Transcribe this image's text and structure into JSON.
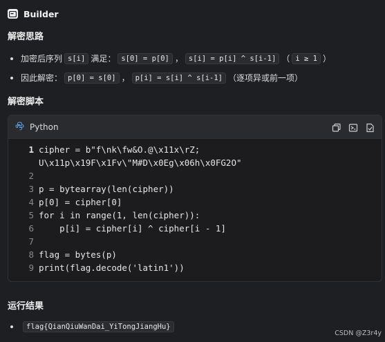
{
  "builder": {
    "label": "Builder",
    "icon": "builder-icon"
  },
  "section1": {
    "title": "解密思路",
    "bullets": [
      {
        "parts": [
          "加密后序列",
          "s[i]",
          "满足：",
          "s[0] = p[0]",
          "，",
          "s[i] = p[i] ^ s[i-1]",
          "（",
          "i ≥ 1",
          "）"
        ]
      },
      {
        "parts": [
          "因此解密：",
          "p[0] = s[0]",
          "，",
          "p[i] = s[i] ^ s[i-1]",
          "（逐项异或前一项）"
        ]
      }
    ]
  },
  "section2": {
    "title": "解密脚本"
  },
  "code": {
    "language": "Python",
    "language_icon": "python-icon",
    "tools": [
      "copy-icon",
      "insert-icon",
      "apply-icon"
    ],
    "line_numbers": [
      "1",
      "2",
      "3",
      "4",
      "5",
      "6",
      "7",
      "8",
      "9"
    ],
    "lines": {
      "l1a": "cipher = b\"f\\nk\\fw&O.@\\x11x\\rZ;",
      "l1b": "U\\x11p\\x19F\\x1Fv\\\"M#D\\x0Eg\\x06h\\x0FG2O\"",
      "l3": "p = bytearray(len(cipher))",
      "l4": "p[0] = cipher[0]",
      "l5": "for i in range(1, len(cipher)):",
      "l6": "    p[i] = cipher[i] ^ cipher[i - 1]",
      "l8": "flag = bytes(p)",
      "l9": "print(flag.decode('latin1'))"
    }
  },
  "section3": {
    "title": "运行结果",
    "result": "flag{QianQiuWanDai_YiTongJiangHu}"
  },
  "watermark": "CSDN @Z3r4y",
  "colors": {
    "background": "#1e1f22",
    "keyword": "#6cb6ff",
    "string": "#e5c07b"
  }
}
